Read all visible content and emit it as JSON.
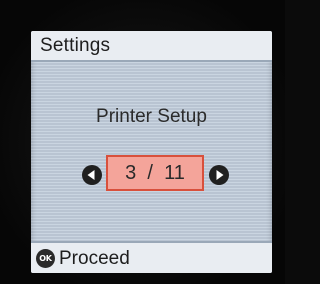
{
  "header": {
    "title": "Settings"
  },
  "main": {
    "label": "Printer Setup",
    "stepper": {
      "current": 3,
      "total": 11,
      "display": "3  /  11",
      "prev_icon": "arrow-left-circle",
      "next_icon": "arrow-right-circle",
      "highlight_color": "#f4a49a",
      "border_color": "#d8503c"
    }
  },
  "footer": {
    "icon_text": "OK",
    "icon": "ok-button-icon",
    "action_label": "Proceed"
  },
  "colors": {
    "screen_background": "#c3cfdd",
    "bar_background": "#e9edf2"
  }
}
